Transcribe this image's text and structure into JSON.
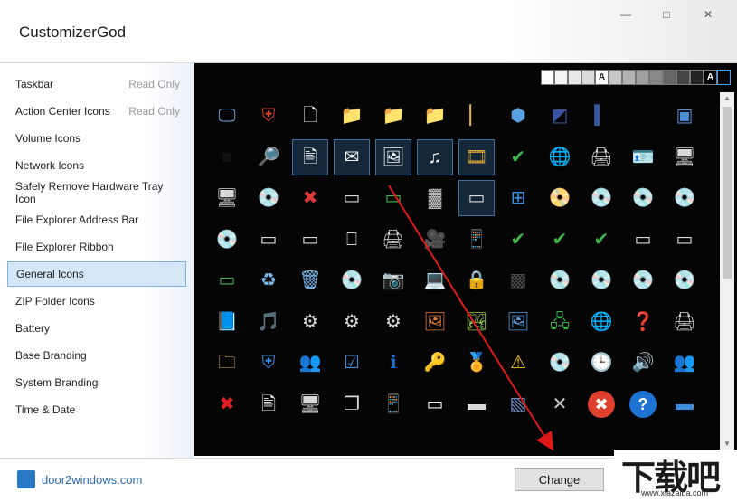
{
  "window": {
    "title": "CustomizerGod",
    "minimize_icon": "—",
    "maximize_icon": "□",
    "close_icon": "✕"
  },
  "sidebar": {
    "items": [
      {
        "label": "Taskbar",
        "badge": "Read Only"
      },
      {
        "label": "Action Center Icons",
        "badge": "Read Only"
      },
      {
        "label": "Volume Icons",
        "badge": ""
      },
      {
        "label": "Network Icons",
        "badge": ""
      },
      {
        "label": "Safely Remove Hardware Tray Icon",
        "badge": ""
      },
      {
        "label": "File Explorer Address Bar",
        "badge": ""
      },
      {
        "label": "File Explorer Ribbon",
        "badge": ""
      },
      {
        "label": "General Icons",
        "badge": "",
        "selected": true
      },
      {
        "label": "ZIP Folder Icons",
        "badge": ""
      },
      {
        "label": "Battery",
        "badge": ""
      },
      {
        "label": "Base Branding",
        "badge": ""
      },
      {
        "label": "System Branding",
        "badge": ""
      },
      {
        "label": "Time & Date",
        "badge": ""
      }
    ]
  },
  "swatches": [
    {
      "color": "#ffffff",
      "label": ""
    },
    {
      "color": "#f4f4f4",
      "label": ""
    },
    {
      "color": "#e8e8e8",
      "label": ""
    },
    {
      "color": "#dcdcdc",
      "label": ""
    },
    {
      "color": "#ffffff",
      "label": "A"
    },
    {
      "color": "#c8c8c8",
      "label": ""
    },
    {
      "color": "#b4b4b4",
      "label": ""
    },
    {
      "color": "#a0a0a0",
      "label": ""
    },
    {
      "color": "#888888",
      "label": ""
    },
    {
      "color": "#666666",
      "label": ""
    },
    {
      "color": "#444444",
      "label": ""
    },
    {
      "color": "#222222",
      "label": ""
    },
    {
      "color": "#000000",
      "label": "A"
    },
    {
      "color": "#050505",
      "label": ""
    }
  ],
  "icon_rows": [
    [
      {
        "icon": "monitor-windows-icon",
        "glyph": "🖵",
        "color": "#6aa8de"
      },
      {
        "icon": "windows-shield-icon",
        "glyph": "⛨",
        "color": "#d8442c"
      },
      {
        "icon": "blank-document-icon",
        "glyph": "🗋",
        "color": "#f4f4f4"
      },
      {
        "icon": "folder-icon",
        "glyph": "📁",
        "color": "#e8b94a"
      },
      {
        "icon": "folder-icon",
        "glyph": "📁",
        "color": "#e8b94a"
      },
      {
        "icon": "folder-icon",
        "glyph": "📁",
        "color": "#e8b94a"
      },
      {
        "icon": "folder-narrow-icon",
        "glyph": "▏",
        "color": "#e8b94a"
      },
      {
        "icon": "cube-search-icon",
        "glyph": "⬢",
        "color": "#5aa0e0"
      },
      {
        "icon": "dark-book-icon",
        "glyph": "◩",
        "color": "#3a55a0"
      },
      {
        "icon": "thin-bar-icon",
        "glyph": "▍",
        "color": "#3a55a0"
      },
      {
        "icon": "",
        "glyph": "",
        "color": ""
      },
      {
        "icon": "window-frame-icon",
        "glyph": "▣",
        "color": "#4b8ed6"
      }
    ],
    [
      {
        "icon": "black-square-icon",
        "glyph": "■",
        "color": "#111111"
      },
      {
        "icon": "folder-search-icon",
        "glyph": "🔎",
        "color": "#e8b94a"
      },
      {
        "icon": "text-document-icon",
        "glyph": "🖹",
        "color": "#f2f2f2",
        "selected": true
      },
      {
        "icon": "email-document-icon",
        "glyph": "✉",
        "color": "#f2f2f2",
        "selected": true
      },
      {
        "icon": "picture-document-icon",
        "glyph": "🖼",
        "color": "#f2f2f2",
        "selected": true
      },
      {
        "icon": "music-document-icon",
        "glyph": "♫",
        "color": "#f2f2f2",
        "selected": true
      },
      {
        "icon": "film-document-icon",
        "glyph": "🎞",
        "color": "#d8a23c",
        "selected": true
      },
      {
        "icon": "window-check-icon",
        "glyph": "✔",
        "color": "#3cb44a"
      },
      {
        "icon": "network-globe-icon",
        "glyph": "🌐",
        "color": "#3c8ee0"
      },
      {
        "icon": "printer-check-icon",
        "glyph": "🖨",
        "color": "#d8d8d8"
      },
      {
        "icon": "id-card-icon",
        "glyph": "🪪",
        "color": "#3c8ee0"
      },
      {
        "icon": "drive-icon",
        "glyph": "🖥",
        "color": "#d8d8d8"
      }
    ],
    [
      {
        "icon": "computer-drive-icon",
        "glyph": "🖥",
        "color": "#d8d8d8"
      },
      {
        "icon": "optical-drive-icon",
        "glyph": "💿",
        "color": "#d8d8d8"
      },
      {
        "icon": "drive-error-icon",
        "glyph": "✖",
        "color": "#e03a3a"
      },
      {
        "icon": "drive-icon",
        "glyph": "▭",
        "color": "#d8d8d8"
      },
      {
        "icon": "network-drive-icon",
        "glyph": "▭",
        "color": "#3cb44a"
      },
      {
        "icon": "memory-chip-icon",
        "glyph": "▓",
        "color": "#bdbdbd"
      },
      {
        "icon": "drive-icon",
        "glyph": "▭",
        "color": "#d8d8d8",
        "selected": true
      },
      {
        "icon": "windows-drive-icon",
        "glyph": "⊞",
        "color": "#3c8ee0"
      },
      {
        "icon": "dvd-drive-icon",
        "glyph": "📀",
        "color": "#d8d8d8"
      },
      {
        "icon": "dvd-r-icon",
        "glyph": "💿",
        "color": "#e8e8e8"
      },
      {
        "icon": "dvd-ram-icon",
        "glyph": "💿",
        "color": "#e8e8e8"
      },
      {
        "icon": "dvd-rom-icon",
        "glyph": "💿",
        "color": "#e8e8e8"
      }
    ],
    [
      {
        "icon": "dvd-rw-icon",
        "glyph": "💿",
        "color": "#e8e8e8"
      },
      {
        "icon": "drive-icon",
        "glyph": "▭",
        "color": "#d8d8d8"
      },
      {
        "icon": "drive-icon",
        "glyph": "▭",
        "color": "#d8d8d8"
      },
      {
        "icon": "server-drive-icon",
        "glyph": "⎕",
        "color": "#d8d8d8"
      },
      {
        "icon": "printer-network-icon",
        "glyph": "🖨",
        "color": "#d8d8d8"
      },
      {
        "icon": "camcorder-icon",
        "glyph": "🎥",
        "color": "#9a9a9a"
      },
      {
        "icon": "phone-icon",
        "glyph": "📱",
        "color": "#3c8ee0"
      },
      {
        "icon": "drive-check-icon",
        "glyph": "✔",
        "color": "#3cb44a"
      },
      {
        "icon": "drive-check-icon",
        "glyph": "✔",
        "color": "#3cb44a"
      },
      {
        "icon": "drive-check-icon",
        "glyph": "✔",
        "color": "#3cb44a"
      },
      {
        "icon": "drive-icon",
        "glyph": "▭",
        "color": "#d8d8d8"
      },
      {
        "icon": "drive-icon",
        "glyph": "▭",
        "color": "#d8d8d8"
      }
    ],
    [
      {
        "icon": "drive-network-icon",
        "glyph": "▭",
        "color": "#3cb44a"
      },
      {
        "icon": "recycle-bin-full-icon",
        "glyph": "♻",
        "color": "#7ab8e8"
      },
      {
        "icon": "recycle-bin-empty-icon",
        "glyph": "🗑",
        "color": "#7ab8e8"
      },
      {
        "icon": "dvd-disc-icon",
        "glyph": "💿",
        "color": "#e8e8e8"
      },
      {
        "icon": "camera-icon",
        "glyph": "📷",
        "color": "#d8d8d8"
      },
      {
        "icon": "computer-icon",
        "glyph": "💻",
        "color": "#d8d8d8"
      },
      {
        "icon": "padlock-icon",
        "glyph": "🔒",
        "color": "#e8b94a"
      },
      {
        "icon": "memory-card-icon",
        "glyph": "▩",
        "color": "#4a4a4a"
      },
      {
        "icon": "cd-disc-icon",
        "glyph": "💿",
        "color": "#e8e8e8"
      },
      {
        "icon": "cd-r-icon",
        "glyph": "💿",
        "color": "#e8e8e8"
      },
      {
        "icon": "cd-rom-icon",
        "glyph": "💿",
        "color": "#e8e8e8"
      },
      {
        "icon": "cd-rw-icon",
        "glyph": "💿",
        "color": "#e8e8e8"
      }
    ],
    [
      {
        "icon": "contacts-book-icon",
        "glyph": "📘",
        "color": "#3c8ee0"
      },
      {
        "icon": "media-player-icon",
        "glyph": "🎵",
        "color": "#d8d8d8"
      },
      {
        "icon": "settings-file-icon",
        "glyph": "⚙",
        "color": "#d8d8d8"
      },
      {
        "icon": "settings-window-icon",
        "glyph": "⚙",
        "color": "#d8d8d8"
      },
      {
        "icon": "gear-document-icon",
        "glyph": "⚙",
        "color": "#d8d8d8"
      },
      {
        "icon": "photo-frame-icon",
        "glyph": "🖼",
        "color": "#d87a3c"
      },
      {
        "icon": "landscape-icon",
        "glyph": "🏞",
        "color": "#8cc04a"
      },
      {
        "icon": "picture-icon",
        "glyph": "🖼",
        "color": "#5a9ad8"
      },
      {
        "icon": "network-computer-icon",
        "glyph": "🖧",
        "color": "#3cb44a"
      },
      {
        "icon": "folder-globe-icon",
        "glyph": "🌐",
        "color": "#e8b94a"
      },
      {
        "icon": "help-drive-icon",
        "glyph": "❓",
        "color": "#3c8ee0"
      },
      {
        "icon": "printer-icon",
        "glyph": "🖨",
        "color": "#d8d8d8"
      }
    ],
    [
      {
        "icon": "folder-font-icon",
        "glyph": "🗀",
        "color": "#e8b94a"
      },
      {
        "icon": "uac-shield-icon",
        "glyph": "⛨",
        "color": "#3c8ee0"
      },
      {
        "icon": "users-icon",
        "glyph": "👥",
        "color": "#e0a080"
      },
      {
        "icon": "checklist-window-icon",
        "glyph": "☑",
        "color": "#3c8ee0"
      },
      {
        "icon": "info-icon",
        "glyph": "ℹ",
        "color": "#1e73d2"
      },
      {
        "icon": "key-icon",
        "glyph": "🔑",
        "color": "#e8b94a"
      },
      {
        "icon": "certificate-icon",
        "glyph": "🏅",
        "color": "#e03a3a"
      },
      {
        "icon": "warning-icon",
        "glyph": "⚠",
        "color": "#f2c21e"
      },
      {
        "icon": "music-disc-icon",
        "glyph": "💿",
        "color": "#3c8ee0"
      },
      {
        "icon": "sync-clock-icon",
        "glyph": "🕒",
        "color": "#3c8ee0"
      },
      {
        "icon": "speaker-icon",
        "glyph": "🔊",
        "color": "#d8d8d8"
      },
      {
        "icon": "users-icon",
        "glyph": "👥",
        "color": "#e0a080"
      }
    ],
    [
      {
        "icon": "red-x-icon",
        "glyph": "✖",
        "color": "#e02020"
      },
      {
        "icon": "text-file-icon",
        "glyph": "🖹",
        "color": "#f2f2f2"
      },
      {
        "icon": "computer-download-icon",
        "glyph": "🖥",
        "color": "#d8d8d8"
      },
      {
        "icon": "stacked-windows-icon",
        "glyph": "❐",
        "color": "#d8d8d8"
      },
      {
        "icon": "mobile-device-icon",
        "glyph": "📱",
        "color": "#3c8ee0"
      },
      {
        "icon": "usb-device-icon",
        "glyph": "▭",
        "color": "#f2f2f2"
      },
      {
        "icon": "scanner-icon",
        "glyph": "▬",
        "color": "#d8d8d8"
      },
      {
        "icon": "blue-panel-icon",
        "glyph": "▧",
        "color": "#6a8ec8"
      },
      {
        "icon": "small-x-icon",
        "glyph": "✕",
        "color": "#c8c8c8"
      },
      {
        "icon": "error-circle-icon",
        "glyph": "✖",
        "color": "#ffffff",
        "bg": "#e0402e"
      },
      {
        "icon": "help-circle-icon",
        "glyph": "?",
        "color": "#ffffff",
        "bg": "#1e73d2"
      },
      {
        "icon": "blue-card-icon",
        "glyph": "▬",
        "color": "#3c8ee0"
      }
    ]
  ],
  "footer": {
    "link_text": "door2windows.com",
    "change_label": "Change"
  },
  "watermark": {
    "text": "下载吧",
    "url": "www.xiazaiba.com"
  },
  "scrollbar": {
    "up_icon": "▲",
    "down_icon": "▼"
  }
}
